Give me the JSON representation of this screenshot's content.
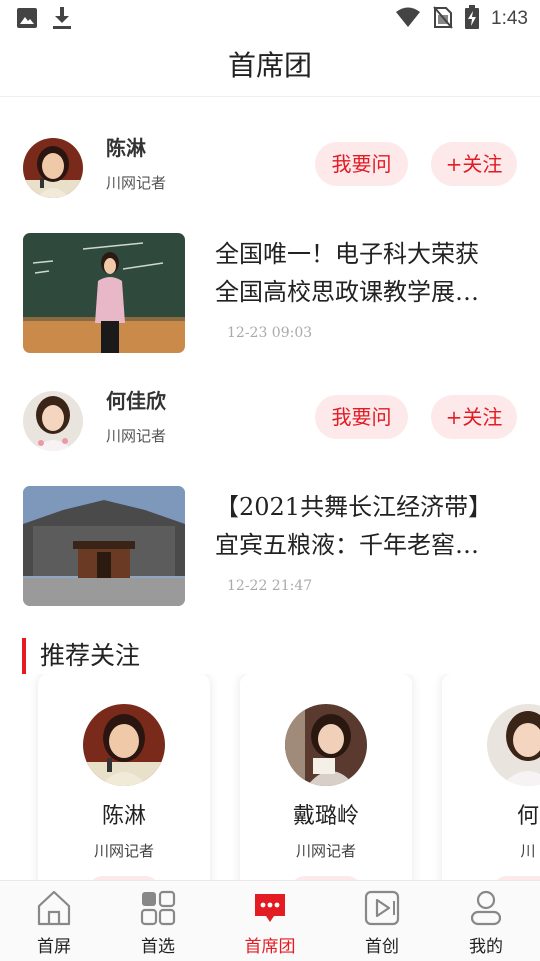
{
  "status_bar": {
    "time": "1:43",
    "icons": [
      "image-icon",
      "download-icon",
      "wifi-icon",
      "no-sim-icon",
      "battery-charging-icon"
    ]
  },
  "header": {
    "title": "首席团"
  },
  "authors": [
    {
      "name": "陈淋",
      "role": "川网记者",
      "ask_label": "我要问",
      "follow_label": "+关注"
    },
    {
      "name": "何佳欣",
      "role": "川网记者",
      "ask_label": "我要问",
      "follow_label": "+关注"
    }
  ],
  "articles": [
    {
      "title_line1": "全国唯一！电子科大荣获",
      "title_line2": "全国高校思政课教学展…",
      "time": "12-23 09:03"
    },
    {
      "title_line1": "【2021共舞长江经济带】",
      "title_line2": "宜宾五粮液：千年老窖…",
      "time": "12-22 21:47"
    }
  ],
  "recommend": {
    "title": "推荐关注",
    "cards": [
      {
        "name": "陈淋",
        "role": "川网记者"
      },
      {
        "name": "戴璐岭",
        "role": "川网记者"
      },
      {
        "name": "何",
        "role": "川"
      }
    ]
  },
  "tabbar": {
    "tabs": [
      {
        "label": "首屏",
        "icon": "home-icon"
      },
      {
        "label": "首选",
        "icon": "grid-icon"
      },
      {
        "label": "首席团",
        "icon": "chat-bubble-icon",
        "active": true
      },
      {
        "label": "首创",
        "icon": "video-icon"
      },
      {
        "label": "我的",
        "icon": "user-icon"
      }
    ]
  },
  "colors": {
    "accent": "#e31b23",
    "pill_bg": "#fde8ea"
  }
}
